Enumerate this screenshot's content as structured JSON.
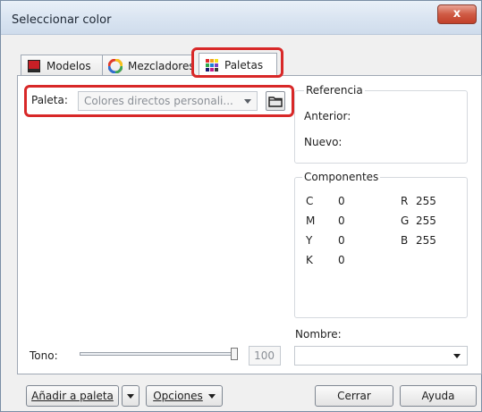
{
  "window": {
    "title": "Seleccionar color",
    "close_label": "x"
  },
  "tabs": [
    {
      "label": "Modelos",
      "icon": "models-icon"
    },
    {
      "label": "Mezcladores",
      "icon": "mixers-icon"
    },
    {
      "label": "Paletas",
      "icon": "palettes-icon",
      "active": true
    }
  ],
  "palette": {
    "label": "Paleta:",
    "selected": "Colores directos personali..."
  },
  "reference": {
    "title": "Referencia",
    "previous": "Anterior:",
    "new": "Nuevo:"
  },
  "components": {
    "title": "Componentes",
    "cmyk": [
      {
        "name": "C",
        "value": "0"
      },
      {
        "name": "M",
        "value": "0"
      },
      {
        "name": "Y",
        "value": "0"
      },
      {
        "name": "K",
        "value": "0"
      }
    ],
    "rgb": [
      {
        "name": "R",
        "value": "255"
      },
      {
        "name": "G",
        "value": "255"
      },
      {
        "name": "B",
        "value": "255"
      }
    ]
  },
  "tone": {
    "label": "Tono:",
    "value": "100",
    "level": 1.0
  },
  "name_field": {
    "label": "Nombre:",
    "value": ""
  },
  "buttons": {
    "add_palette": "Añadir a paleta",
    "options": "Opciones",
    "close": "Cerrar",
    "help": "Ayuda"
  },
  "colors": {
    "highlight": "#d82828",
    "title_gradient_top": "#e9f0f8",
    "close_red": "#c2402a"
  }
}
